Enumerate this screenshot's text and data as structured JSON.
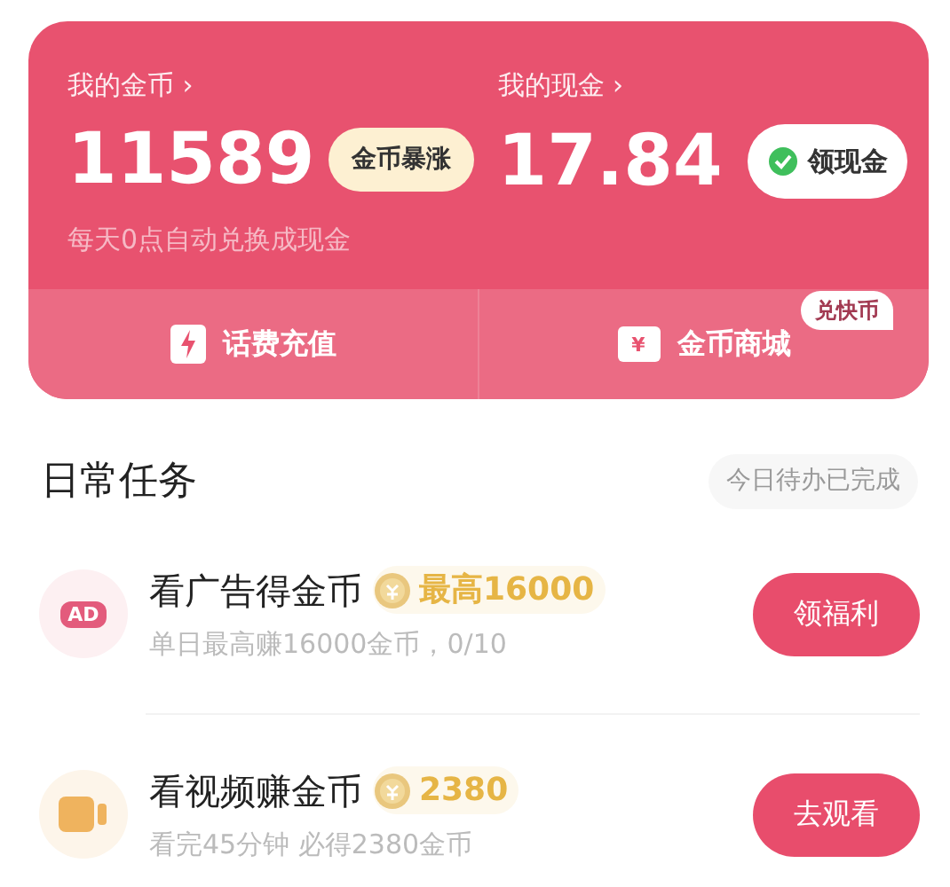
{
  "wallet": {
    "coins": {
      "label": "我的金币",
      "chevron": "›",
      "amount": "11589",
      "promo": "金币暴涨"
    },
    "cash": {
      "label": "我的现金",
      "chevron": "›",
      "amount": "17.84",
      "action": "领现金"
    },
    "note": "每天0点自动兑换成现金",
    "shortcuts": [
      {
        "kind": "bolt",
        "label": "话费充值"
      },
      {
        "kind": "ticket",
        "icon_text": "¥",
        "label": "金币商城",
        "badge": "兑快币"
      }
    ]
  },
  "daily_tasks": {
    "title": "日常任务",
    "status": "今日待办已完成",
    "tasks": [
      {
        "kind": "ad",
        "icon_text": "AD",
        "title": "看广告得金币",
        "reward": "最高16000",
        "subtitle": "单日最高赚16000金币，0/10",
        "button": "领福利"
      },
      {
        "kind": "video",
        "title": "看视频赚金币",
        "reward": "2380",
        "subtitle": "看完45分钟 必得2380金币",
        "button": "去观看"
      }
    ]
  }
}
